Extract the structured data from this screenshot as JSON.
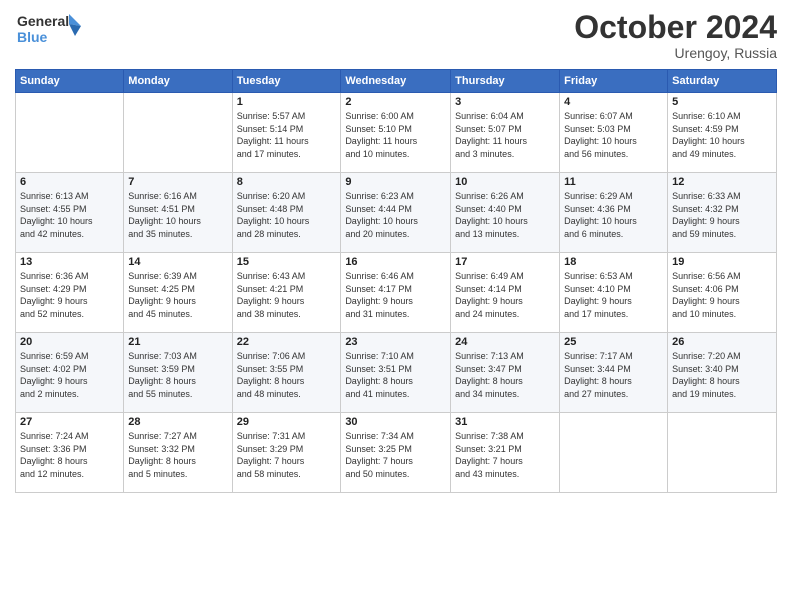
{
  "header": {
    "logo_line1": "General",
    "logo_line2": "Blue",
    "month_title": "October 2024",
    "location": "Urengoy, Russia"
  },
  "weekdays": [
    "Sunday",
    "Monday",
    "Tuesday",
    "Wednesday",
    "Thursday",
    "Friday",
    "Saturday"
  ],
  "weeks": [
    [
      {
        "day": "",
        "detail": ""
      },
      {
        "day": "",
        "detail": ""
      },
      {
        "day": "1",
        "detail": "Sunrise: 5:57 AM\nSunset: 5:14 PM\nDaylight: 11 hours\nand 17 minutes."
      },
      {
        "day": "2",
        "detail": "Sunrise: 6:00 AM\nSunset: 5:10 PM\nDaylight: 11 hours\nand 10 minutes."
      },
      {
        "day": "3",
        "detail": "Sunrise: 6:04 AM\nSunset: 5:07 PM\nDaylight: 11 hours\nand 3 minutes."
      },
      {
        "day": "4",
        "detail": "Sunrise: 6:07 AM\nSunset: 5:03 PM\nDaylight: 10 hours\nand 56 minutes."
      },
      {
        "day": "5",
        "detail": "Sunrise: 6:10 AM\nSunset: 4:59 PM\nDaylight: 10 hours\nand 49 minutes."
      }
    ],
    [
      {
        "day": "6",
        "detail": "Sunrise: 6:13 AM\nSunset: 4:55 PM\nDaylight: 10 hours\nand 42 minutes."
      },
      {
        "day": "7",
        "detail": "Sunrise: 6:16 AM\nSunset: 4:51 PM\nDaylight: 10 hours\nand 35 minutes."
      },
      {
        "day": "8",
        "detail": "Sunrise: 6:20 AM\nSunset: 4:48 PM\nDaylight: 10 hours\nand 28 minutes."
      },
      {
        "day": "9",
        "detail": "Sunrise: 6:23 AM\nSunset: 4:44 PM\nDaylight: 10 hours\nand 20 minutes."
      },
      {
        "day": "10",
        "detail": "Sunrise: 6:26 AM\nSunset: 4:40 PM\nDaylight: 10 hours\nand 13 minutes."
      },
      {
        "day": "11",
        "detail": "Sunrise: 6:29 AM\nSunset: 4:36 PM\nDaylight: 10 hours\nand 6 minutes."
      },
      {
        "day": "12",
        "detail": "Sunrise: 6:33 AM\nSunset: 4:32 PM\nDaylight: 9 hours\nand 59 minutes."
      }
    ],
    [
      {
        "day": "13",
        "detail": "Sunrise: 6:36 AM\nSunset: 4:29 PM\nDaylight: 9 hours\nand 52 minutes."
      },
      {
        "day": "14",
        "detail": "Sunrise: 6:39 AM\nSunset: 4:25 PM\nDaylight: 9 hours\nand 45 minutes."
      },
      {
        "day": "15",
        "detail": "Sunrise: 6:43 AM\nSunset: 4:21 PM\nDaylight: 9 hours\nand 38 minutes."
      },
      {
        "day": "16",
        "detail": "Sunrise: 6:46 AM\nSunset: 4:17 PM\nDaylight: 9 hours\nand 31 minutes."
      },
      {
        "day": "17",
        "detail": "Sunrise: 6:49 AM\nSunset: 4:14 PM\nDaylight: 9 hours\nand 24 minutes."
      },
      {
        "day": "18",
        "detail": "Sunrise: 6:53 AM\nSunset: 4:10 PM\nDaylight: 9 hours\nand 17 minutes."
      },
      {
        "day": "19",
        "detail": "Sunrise: 6:56 AM\nSunset: 4:06 PM\nDaylight: 9 hours\nand 10 minutes."
      }
    ],
    [
      {
        "day": "20",
        "detail": "Sunrise: 6:59 AM\nSunset: 4:02 PM\nDaylight: 9 hours\nand 2 minutes."
      },
      {
        "day": "21",
        "detail": "Sunrise: 7:03 AM\nSunset: 3:59 PM\nDaylight: 8 hours\nand 55 minutes."
      },
      {
        "day": "22",
        "detail": "Sunrise: 7:06 AM\nSunset: 3:55 PM\nDaylight: 8 hours\nand 48 minutes."
      },
      {
        "day": "23",
        "detail": "Sunrise: 7:10 AM\nSunset: 3:51 PM\nDaylight: 8 hours\nand 41 minutes."
      },
      {
        "day": "24",
        "detail": "Sunrise: 7:13 AM\nSunset: 3:47 PM\nDaylight: 8 hours\nand 34 minutes."
      },
      {
        "day": "25",
        "detail": "Sunrise: 7:17 AM\nSunset: 3:44 PM\nDaylight: 8 hours\nand 27 minutes."
      },
      {
        "day": "26",
        "detail": "Sunrise: 7:20 AM\nSunset: 3:40 PM\nDaylight: 8 hours\nand 19 minutes."
      }
    ],
    [
      {
        "day": "27",
        "detail": "Sunrise: 7:24 AM\nSunset: 3:36 PM\nDaylight: 8 hours\nand 12 minutes."
      },
      {
        "day": "28",
        "detail": "Sunrise: 7:27 AM\nSunset: 3:32 PM\nDaylight: 8 hours\nand 5 minutes."
      },
      {
        "day": "29",
        "detail": "Sunrise: 7:31 AM\nSunset: 3:29 PM\nDaylight: 7 hours\nand 58 minutes."
      },
      {
        "day": "30",
        "detail": "Sunrise: 7:34 AM\nSunset: 3:25 PM\nDaylight: 7 hours\nand 50 minutes."
      },
      {
        "day": "31",
        "detail": "Sunrise: 7:38 AM\nSunset: 3:21 PM\nDaylight: 7 hours\nand 43 minutes."
      },
      {
        "day": "",
        "detail": ""
      },
      {
        "day": "",
        "detail": ""
      }
    ]
  ]
}
